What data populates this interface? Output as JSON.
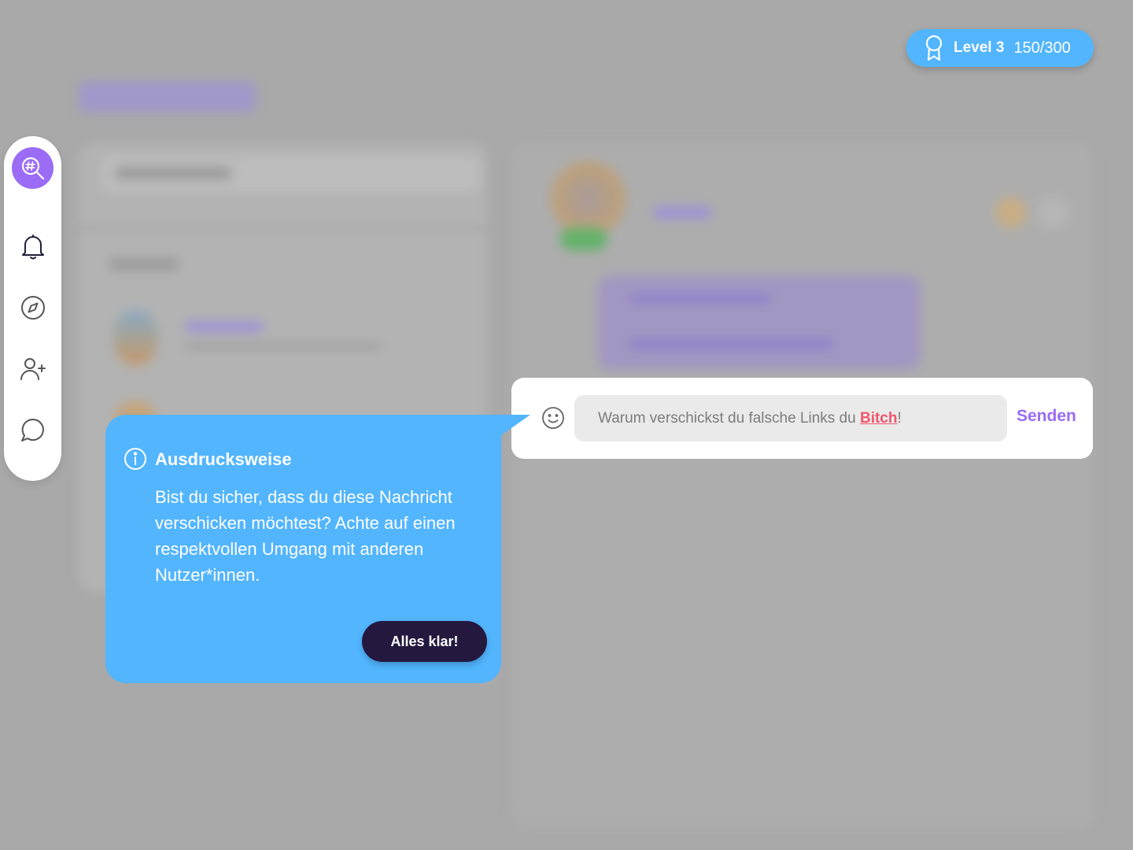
{
  "level": {
    "label": "Level 3",
    "progress": "150/300",
    "icon": "award-ribbon-icon",
    "color": "#52b5fe"
  },
  "sidebar": {
    "items": [
      {
        "icon": "hashtag-search-icon",
        "active": true
      },
      {
        "icon": "bell-icon"
      },
      {
        "icon": "compass-icon"
      },
      {
        "icon": "add-user-icon"
      },
      {
        "icon": "chat-bubble-icon"
      }
    ],
    "accent": "#9b6cf6"
  },
  "composer": {
    "message_before": "Warum verschickst du falsche Links du ",
    "flagged_word": "Bitch",
    "message_after": "!",
    "send_label": "Senden",
    "flag_color": "#f2546b"
  },
  "warning": {
    "title": "Ausdrucksweise",
    "body": "Bist du sicher, dass du diese Nachricht verschicken möchtest? Achte auf einen respektvollen Umgang mit anderen Nutzer*innen.",
    "button_label": "Alles klar!",
    "icon": "info-icon",
    "background": "#52b5fe",
    "button_color": "#24183f"
  }
}
